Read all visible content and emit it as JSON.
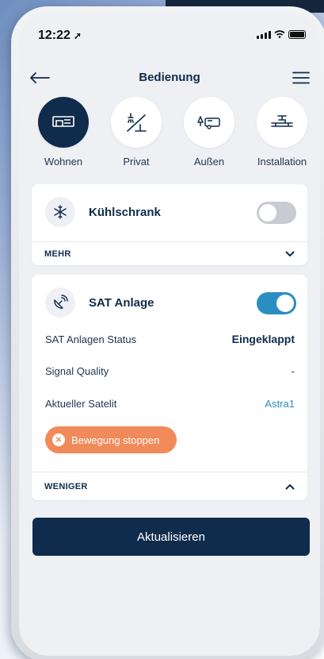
{
  "status_bar": {
    "time": "12:22",
    "location_icon": "location-arrow-icon",
    "signal_icon": "cellular-signal-icon",
    "wifi_icon": "wifi-icon",
    "battery_icon": "battery-icon"
  },
  "header": {
    "title": "Bedienung",
    "back_icon": "arrow-left-icon",
    "menu_icon": "hamburger-menu-icon"
  },
  "categories": [
    {
      "label": "Wohnen",
      "icon": "living-room-icon",
      "active": true
    },
    {
      "label": "Privat",
      "icon": "shower-icon",
      "active": false
    },
    {
      "label": "Außen",
      "icon": "outdoor-camper-icon",
      "active": false
    },
    {
      "label": "Installation",
      "icon": "installation-pipe-icon",
      "active": false
    }
  ],
  "devices": {
    "fridge": {
      "name": "Kühlschrank",
      "icon": "snowflake-icon",
      "state": "off",
      "more_label": "MEHR"
    },
    "sat": {
      "name": "SAT Anlage",
      "icon": "satellite-dish-icon",
      "state": "on",
      "rows": [
        {
          "label": "SAT Anlagen Status",
          "value": "Eingeklappt"
        },
        {
          "label": "Signal Quality",
          "value": "-"
        },
        {
          "label": "Aktueller Satelit",
          "value": "Astra1"
        }
      ],
      "stop_button": "Bewegung stoppen",
      "less_label": "WENIGER"
    }
  },
  "update_button": "Aktualisieren",
  "colors": {
    "navy": "#0f2c4c",
    "accent_blue": "#2b8ec2",
    "stop_orange": "#f08a5a",
    "toggle_off": "#c8ccd2"
  }
}
